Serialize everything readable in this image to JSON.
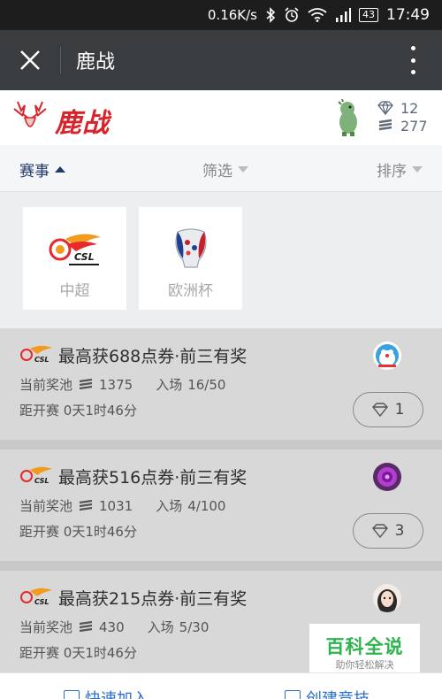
{
  "status_bar": {
    "speed": "0.16K/s",
    "battery": "43",
    "time": "17:49",
    "icons": [
      "bluetooth-icon",
      "alarm-icon",
      "wifi-icon",
      "signal-icon",
      "battery-icon"
    ]
  },
  "app_bar": {
    "title": "鹿战",
    "icons": [
      "close-icon",
      "more-icon"
    ]
  },
  "brand": {
    "name": "鹿战",
    "diamonds": "12",
    "coins": "277",
    "colors": {
      "brand_red": "#d8232a",
      "stat_text": "#5e6a7a"
    }
  },
  "filters": {
    "event_label": "赛事",
    "filter_label": "筛选",
    "sort_label": "排序"
  },
  "leagues": [
    {
      "name": "中超",
      "icon": "csl-logo"
    },
    {
      "name": "欧洲杯",
      "icon": "euro-cup-logo"
    }
  ],
  "pool_label": "当前奖池",
  "entry_label": "入场",
  "countdown_label": "距开赛",
  "matches": [
    {
      "title": "最高获688点券·前三有奖",
      "pool": "1375",
      "entry": "16/50",
      "countdown": "0天1时46分",
      "fee": "1"
    },
    {
      "title": "最高获516点券·前三有奖",
      "pool": "1031",
      "entry": "4/100",
      "countdown": "0天1时46分",
      "fee": "3"
    },
    {
      "title": "最高获215点券·前三有奖",
      "pool": "430",
      "entry": "5/30",
      "countdown": "0天1时46分",
      "fee": ""
    }
  ],
  "watermark": {
    "title": "百科全说",
    "subtitle": "助你轻松解决"
  },
  "bottom_bar": {
    "quick_join": "快速加入",
    "create": "创建竞技"
  }
}
